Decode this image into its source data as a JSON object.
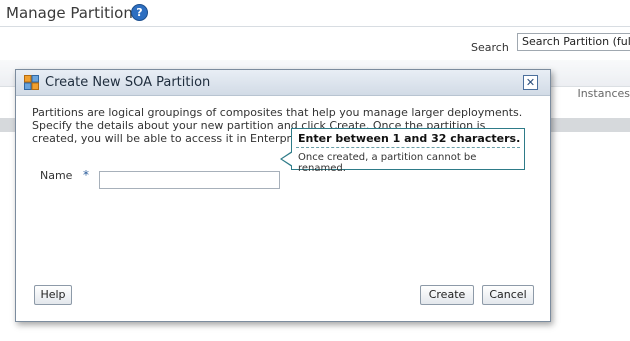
{
  "page": {
    "title": "Manage Partitions",
    "help_glyph": "?",
    "search_label": "Search",
    "search_value": "Search Partition (full or",
    "column_header": "Instances"
  },
  "dialog": {
    "title": "Create New SOA Partition",
    "close_glyph": "✕",
    "description": "Partitions are logical groupings of composites that help you manage larger deployments. Specify the details about your new partition and click Create. Once the partition is created, you will be able to access it in Enterprise Manager's navigation tree.",
    "name_label": "Name",
    "required_marker": "*",
    "name_value": "",
    "tooltip_title": "Enter between 1 and 32 characters.",
    "tooltip_text": "Once created, a partition cannot be renamed.",
    "help_button": "Help",
    "create_button": "Create",
    "cancel_button": "Cancel"
  },
  "icons": {
    "help": "question-circle-icon",
    "dialog": "soa-partition-icon",
    "close": "close-icon"
  },
  "colors": {
    "accent": "#2e6fc1",
    "tooltip_border": "#2e7b88",
    "dialog_border": "#7c8c9e"
  }
}
